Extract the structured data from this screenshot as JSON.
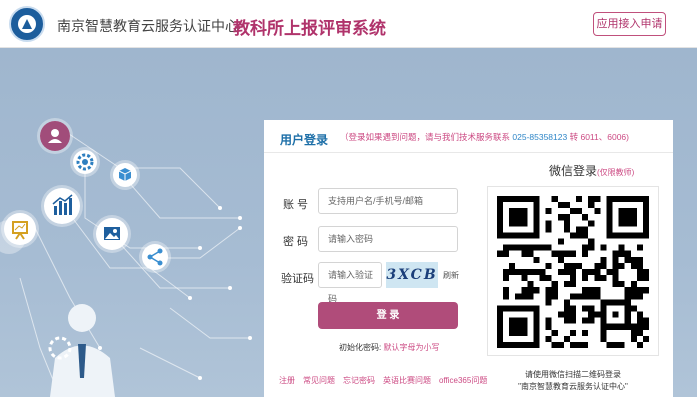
{
  "header": {
    "org_name": "南京智慧教育云服务认证中心",
    "system_title": "教科所上报评审系统",
    "apply_button": "应用接入申请"
  },
  "carousel": {
    "prev_arrow": "‹"
  },
  "login": {
    "title": "用户登录",
    "tip_prefix": "（登录如果遇到问题，请与我们技术服务联系",
    "tip_phone": "025-85358123",
    "tip_suffix": "转 6011、6006)",
    "account_label": "账  号",
    "account_placeholder": "支持用户名/手机号/邮箱",
    "password_label": "密  码",
    "password_placeholder": "请输入密码",
    "captcha_label": "验证码",
    "captcha_placeholder": "请输入验证码",
    "captcha_text": "3XCB",
    "refresh_label": "刷新",
    "login_button": "登 录",
    "init_password_label": "初始化密码:",
    "init_password_value": "默认字母为小写",
    "links": [
      "注册",
      "常见问题",
      "忘记密码",
      "英语比赛问题",
      "office365问题"
    ]
  },
  "wechat": {
    "title": "微信登录",
    "subtitle": "(仅限教师)",
    "note_line1": "请使用微信扫描二维码登录",
    "note_line2": "\"南京智慧教育云服务认证中心\""
  },
  "colors": {
    "brand": "#b0336b",
    "accent": "#1d6fa8",
    "button": "#b04c7a",
    "background": "#a6bcd3"
  }
}
